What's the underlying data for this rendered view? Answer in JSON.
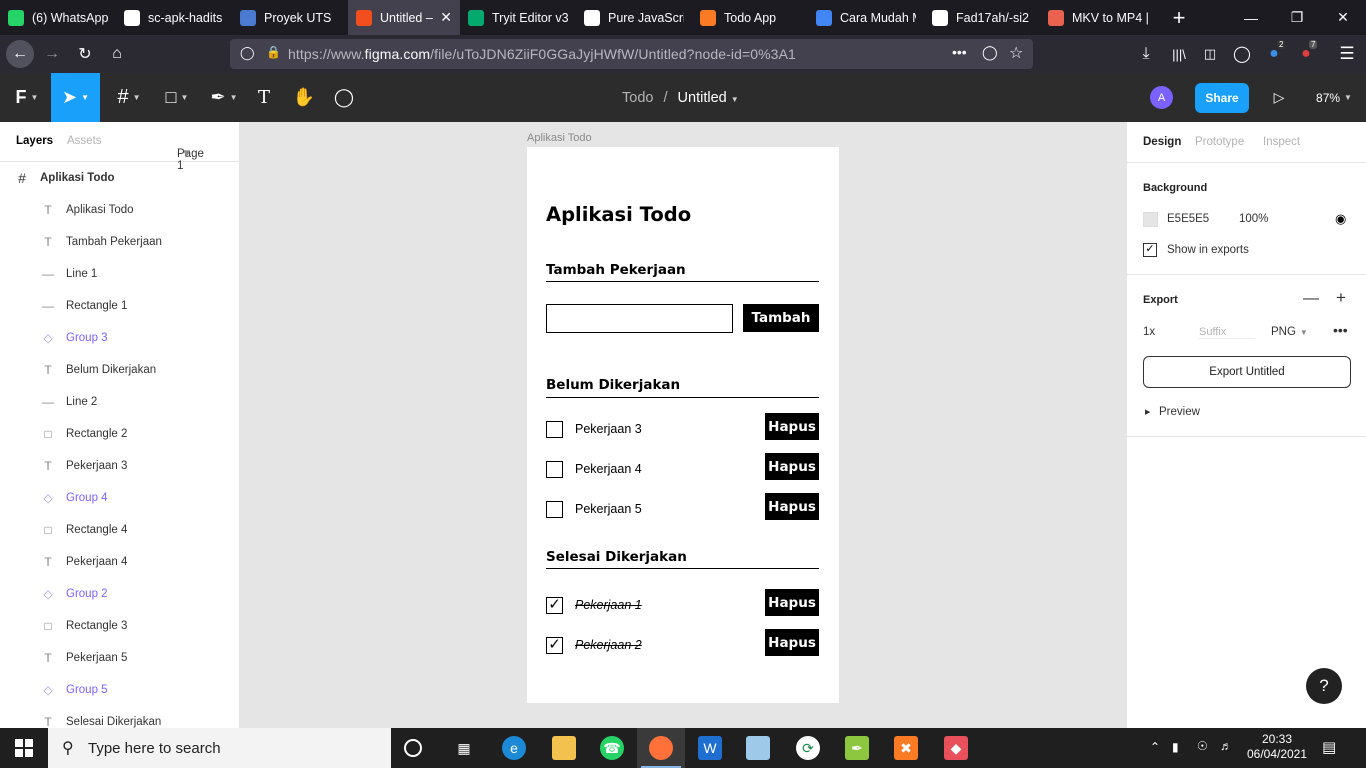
{
  "browser": {
    "tabs": [
      {
        "title": "(6) WhatsApp",
        "icon": "whatsapp-icon",
        "color": "#25d366"
      },
      {
        "title": "sc-apk-hadits",
        "icon": "github-icon",
        "color": "#ffffff"
      },
      {
        "title": "Proyek UTS",
        "icon": "shield-icon",
        "color": "#4a7bd0"
      },
      {
        "title": "Untitled –",
        "icon": "figma-icon",
        "color": "#f24e1e"
      },
      {
        "title": "Tryit Editor v3",
        "icon": "w3schools-icon",
        "color": "#04aa6d"
      },
      {
        "title": "Pure JavaScrip",
        "icon": "codepen-icon",
        "color": "#ffffff"
      },
      {
        "title": "Todo App",
        "icon": "xampp-icon",
        "color": "#fb7a24"
      },
      {
        "title": "Cara Mudah M",
        "icon": "document-icon",
        "color": "#4285f4"
      },
      {
        "title": "Fad17ah/-si2",
        "icon": "github-icon",
        "color": "#ffffff"
      },
      {
        "title": "MKV to MP4 |",
        "icon": "cloud-icon",
        "color": "#e8624f"
      }
    ],
    "url_prefix": "https://www.",
    "url_domain": "figma.com",
    "url_path": "/file/uToJDN6ZiiF0GGaJyjHWfW/Untitled?node-id=0%3A1",
    "badge_2": "2",
    "badge_7": "7"
  },
  "figma": {
    "breadcrumb_project": "Todo",
    "breadcrumb_sep": "/",
    "breadcrumb_file": "Untitled",
    "avatar_letter": "A",
    "share_label": "Share",
    "zoom": "87%",
    "left_tabs": {
      "layers": "Layers",
      "assets": "Assets",
      "page": "Page 1"
    },
    "layers": [
      {
        "name": "Aplikasi Todo",
        "type": "frame"
      },
      {
        "name": "Aplikasi Todo",
        "type": "text"
      },
      {
        "name": "Tambah Pekerjaan",
        "type": "text"
      },
      {
        "name": "Line 1",
        "type": "line"
      },
      {
        "name": "Rectangle 1",
        "type": "line"
      },
      {
        "name": "Group 3",
        "type": "group"
      },
      {
        "name": "Belum Dikerjakan",
        "type": "text"
      },
      {
        "name": "Line 2",
        "type": "line"
      },
      {
        "name": "Rectangle 2",
        "type": "rect"
      },
      {
        "name": "Pekerjaan 3",
        "type": "text"
      },
      {
        "name": "Group 4",
        "type": "group"
      },
      {
        "name": "Rectangle 4",
        "type": "rect"
      },
      {
        "name": "Pekerjaan 4",
        "type": "text"
      },
      {
        "name": "Group 2",
        "type": "group"
      },
      {
        "name": "Rectangle 3",
        "type": "rect"
      },
      {
        "name": "Pekerjaan 5",
        "type": "text"
      },
      {
        "name": "Group 5",
        "type": "group"
      },
      {
        "name": "Selesai Dikerjakan",
        "type": "text"
      }
    ],
    "right": {
      "tabs": {
        "design": "Design",
        "prototype": "Prototype",
        "inspect": "Inspect"
      },
      "background_label": "Background",
      "bg_hex": "E5E5E5",
      "bg_opacity": "100%",
      "show_in_exports": "Show in exports",
      "export_label": "Export",
      "scale": "1x",
      "suffix_placeholder": "Suffix",
      "format": "PNG",
      "export_button": "Export Untitled",
      "preview": "Preview"
    }
  },
  "canvas": {
    "frame_label": "Aplikasi Todo",
    "title": "Aplikasi Todo",
    "add_heading": "Tambah Pekerjaan",
    "add_button": "Tambah",
    "todo_heading": "Belum Dikerjakan",
    "done_heading": "Selesai Dikerjakan",
    "delete_label": "Hapus",
    "todo_items": [
      "Pekerjaan 3",
      "Pekerjaan 4",
      "Pekerjaan 5"
    ],
    "done_items": [
      "Pekerjaan 1",
      "Pekerjaan 2"
    ]
  },
  "taskbar": {
    "search_placeholder": "Type here to search",
    "time": "20:33",
    "date": "06/04/2021"
  }
}
